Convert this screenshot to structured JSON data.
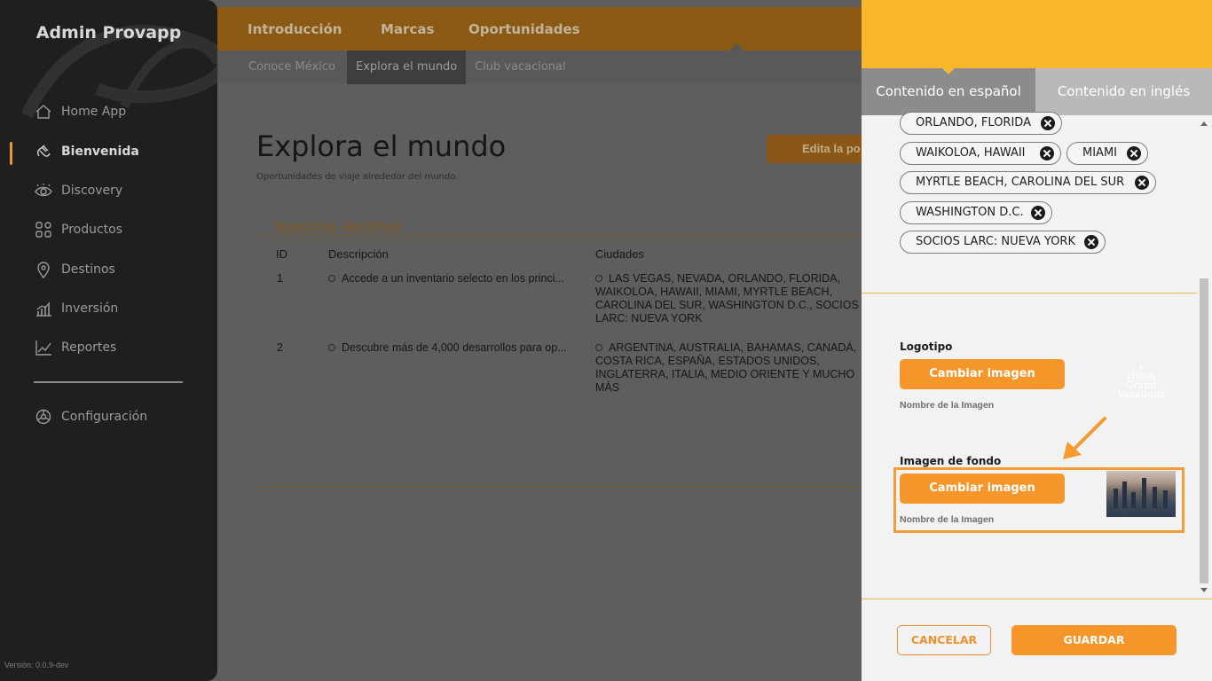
{
  "sidebar": {
    "brand": "Admin Provapp",
    "items": [
      {
        "label": "Home App",
        "icon": "home-icon"
      },
      {
        "label": "Bienvenida",
        "icon": "waving-hand-icon"
      },
      {
        "label": "Discovery",
        "icon": "eye-icon"
      },
      {
        "label": "Productos",
        "icon": "grid-icon"
      },
      {
        "label": "Destinos",
        "icon": "map-pin-icon"
      },
      {
        "label": "Inversión",
        "icon": "bar-chart-icon"
      },
      {
        "label": "Reportes",
        "icon": "line-chart-icon"
      }
    ],
    "active": "Bienvenida",
    "settings": {
      "label": "Configuración",
      "icon": "gear-icon"
    },
    "version": "Versión: 0.0.9-dev"
  },
  "header": {
    "tabs": [
      "Introducción",
      "Marcas",
      "Oportunidades"
    ],
    "active_tab": "Oportunidades",
    "subtabs": [
      "Conoce México",
      "Explora el mundo",
      "Club vacacional"
    ],
    "active_subtab": "Explora el mundo"
  },
  "main": {
    "title": "Explora el mundo",
    "subtitle": "Oportunidades de viaje alrededor del mundo.",
    "edit_button": "Edita la po",
    "section_title": "Nuestros destinos",
    "table": {
      "headers": [
        "ID",
        "Descripción",
        "Ciudades"
      ],
      "rows": [
        {
          "id": "1",
          "description": "Accede a un inventario selecto en los princi...",
          "cities": "LAS VEGAS, NEVADA, ORLANDO, FLORIDA, WAIKOLOA, HAWAII, MIAMI, MYRTLE BEACH, CAROLINA DEL SUR, WASHINGTON D.C., SOCIOS LARC: NUEVA YORK"
        },
        {
          "id": "2",
          "description": "Descubre más de 4,000 desarrollos para op...",
          "cities": "ARGENTINA, AUSTRALIA, BAHAMAS, CANADÁ, COSTA RICA, ESPAÑA, ESTADOS UNIDOS, INGLATERRA, ITALIA, MEDIO ORIENTE Y MUCHO MÁS"
        }
      ]
    }
  },
  "panel": {
    "tabs": [
      "Contenido en español",
      "Contenido en inglés"
    ],
    "active_tab": "Contenido en español",
    "chips": [
      "ORLANDO, FLORIDA",
      "WAIKOLOA, HAWAII",
      "MIAMI",
      "MYRTLE BEACH, CAROLINA DEL SUR",
      "WASHINGTON D.C.",
      "SOCIOS LARC: NUEVA YORK"
    ],
    "logo": {
      "label": "Logotipo",
      "button": "Cambiar imagen",
      "image_name_label": "Nombre de la Imagen",
      "preview_text": [
        "Hilton",
        "Grand Vacations"
      ]
    },
    "background": {
      "label": "Imagen de fondo",
      "button": "Cambiar imagen",
      "image_name_label": "Nombre de la Imagen"
    },
    "cancel": "CANCELAR",
    "save": "GUARDAR"
  },
  "colors": {
    "accent": "#f5962b",
    "panel_header": "#f8b62a",
    "sidebar_bg": "#1f1f1f",
    "highlight": "#f49b3a"
  }
}
